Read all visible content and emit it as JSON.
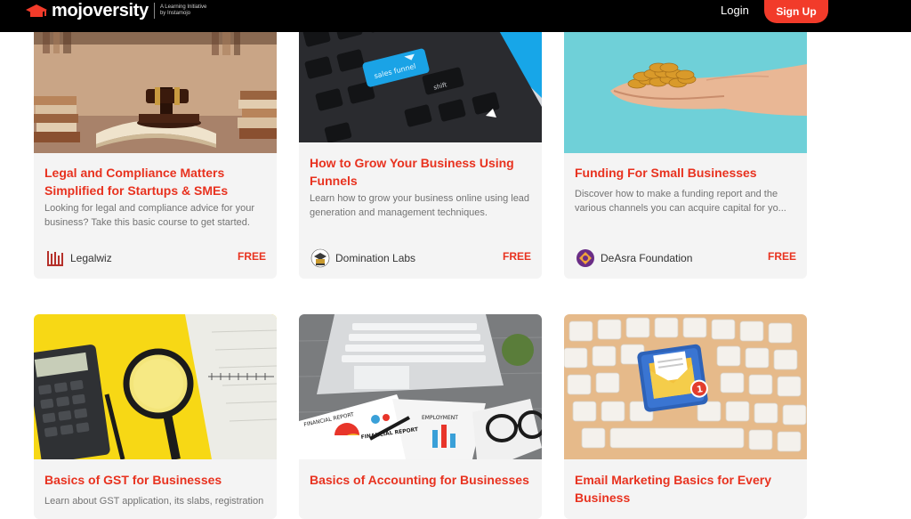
{
  "header": {
    "brand": "mojoversity",
    "tagline_1": "A Learning Initiative",
    "tagline_2": "by Instamojo",
    "login_label": "Login",
    "signup_label": "Sign Up"
  },
  "courses": [
    {
      "title": "Legal and Compliance Matters Simplified for Startups & SMEs",
      "description": "Looking for legal and compliance advice for your business? Take this basic course to get started.",
      "provider": "Legalwiz",
      "price": "FREE",
      "image": "law-books-gavel-image"
    },
    {
      "title": "How to Grow Your Business Using Funnels",
      "description": "Learn how to grow your business online using lead generation and management techniques.",
      "provider": "Domination Labs",
      "price": "FREE",
      "image": "keyboard-sales-funnel-image",
      "image_key_text_1": "sales funnel",
      "image_key_text_2": "shift"
    },
    {
      "title": "Funding For Small Businesses",
      "description": "Discover how to make a funding report and the various channels you can acquire capital for yo...",
      "provider": "DeAsra Foundation",
      "price": "FREE",
      "image": "hand-holding-coins-image"
    },
    {
      "title": "Basics of GST for Businesses",
      "description": "Learn about GST application, its slabs, registration",
      "image": "calculator-magnifier-image"
    },
    {
      "title": "Basics of Accounting for Businesses",
      "description": "",
      "image": "financial-report-laptop-image",
      "image_text_1": "FINANCIAL REPORT",
      "image_text_2": "FINANCIAL REPORT",
      "image_text_3": "EMPLOYMENT"
    },
    {
      "title": "Email Marketing Basics for Every Business",
      "description": "",
      "image": "email-keyboard-image",
      "image_badge": "1"
    }
  ],
  "colors": {
    "accent": "#e8321f",
    "signup_bg": "#f23b2a",
    "card_bg": "#f4f4f4",
    "topbar_bg": "#000000"
  }
}
